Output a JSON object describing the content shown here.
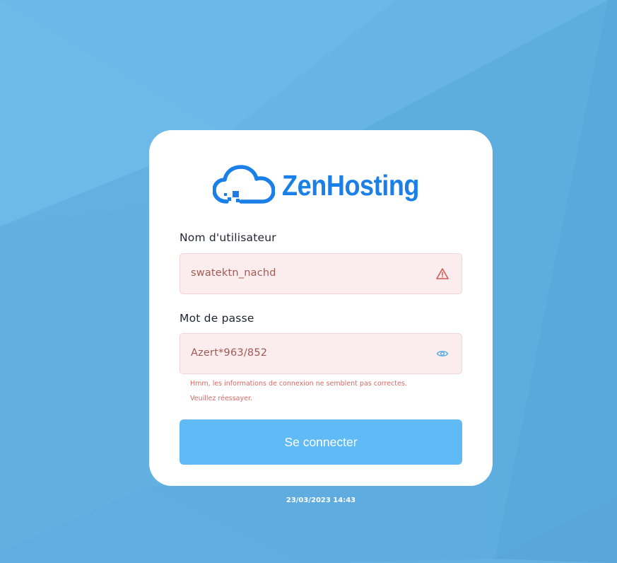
{
  "brand": {
    "name": "ZenHosting",
    "color": "#1a7fe6",
    "logo_icon": "cloud-icon"
  },
  "form": {
    "username_label": "Nom d'utilisateur",
    "username_value": "swatektn_nachd",
    "username_icon": "warning-icon",
    "password_label": "Mot de passe",
    "password_value": "Azert*963/852",
    "password_icon": "eye-icon",
    "error_line1": "Hmm, les informations de connexion ne semblent pas correctes.",
    "error_line2": "Veuillez réessayer.",
    "submit_label": "Se connecter"
  },
  "footer": {
    "timestamp": "23/03/2023 14:43"
  },
  "colors": {
    "background": "#64b2e4",
    "button": "#5fbaf5",
    "field_error_bg": "#fbeced",
    "error_text": "#d46a66"
  }
}
